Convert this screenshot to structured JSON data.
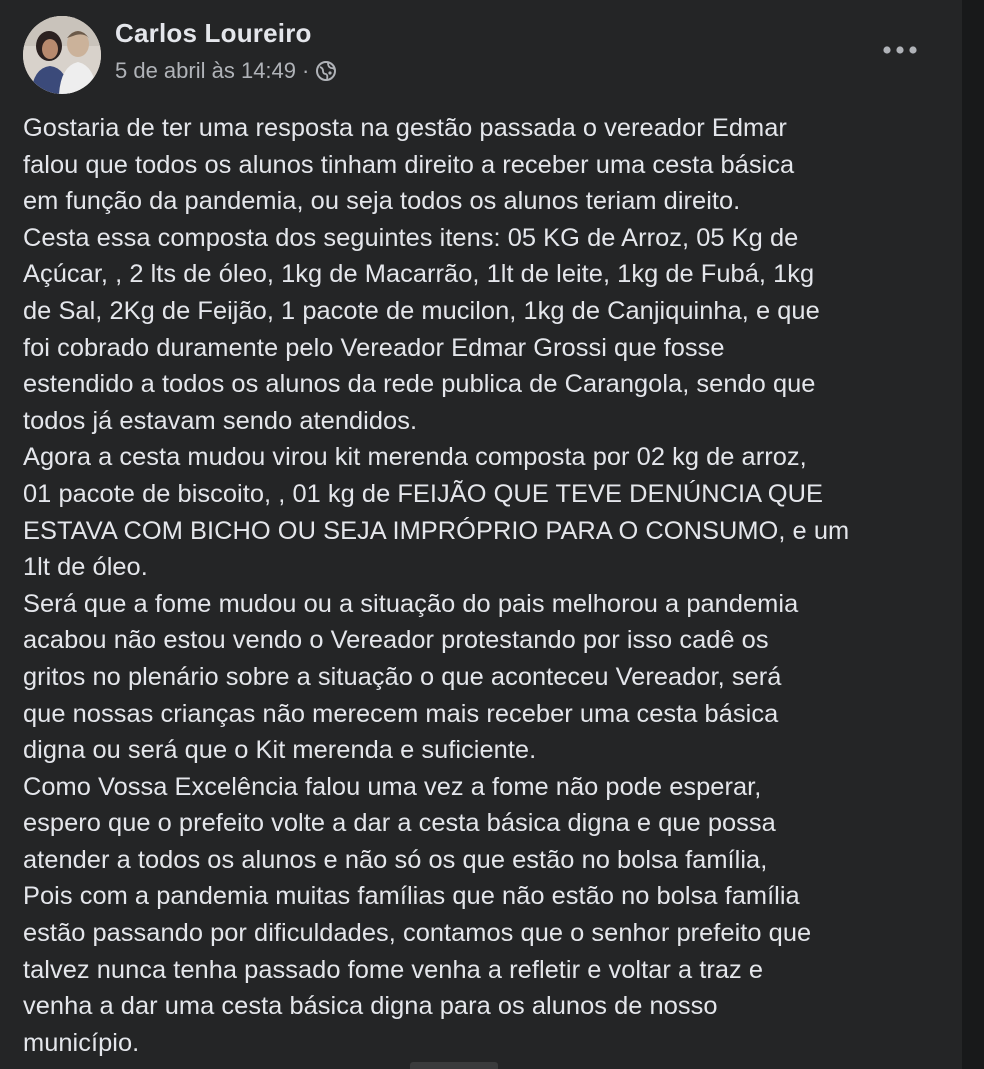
{
  "post": {
    "author": "Carlos Loureiro",
    "timestamp": "5 de abril às 14:49",
    "separator": "·",
    "privacy_icon": "globe-icon",
    "more_icon": "more-options-icon",
    "lines": [
      "Gostaria de ter uma resposta na gestão passada o vereador Edmar",
      "falou que todos os alunos tinham direito a receber uma cesta básica",
      "em função da pandemia, ou seja todos os alunos teriam direito.",
      "Cesta essa composta dos seguintes itens: 05 KG de Arroz, 05 Kg de",
      "Açúcar, , 2 lts de óleo, 1kg de Macarrão, 1lt de leite, 1kg de Fubá, 1kg",
      "de Sal, 2Kg de Feijão, 1 pacote de mucilon, 1kg de Canjiquinha, e que",
      "foi cobrado duramente pelo Vereador Edmar Grossi que fosse",
      "estendido a todos os alunos da rede publica de Carangola, sendo que",
      "todos já estavam sendo atendidos.",
      "Agora a cesta mudou virou kit merenda composta por 02 kg de arroz,",
      "01 pacote de biscoito, , 01 kg de FEIJÃO QUE TEVE DENÚNCIA QUE",
      "ESTAVA COM BICHO OU SEJA IMPRÓPRIO PARA O CONSUMO, e um",
      "1lt de óleo.",
      "Será que a fome mudou ou a situação do pais melhorou a pandemia",
      "acabou não estou vendo o Vereador protestando por isso cadê os",
      "gritos no plenário sobre a situação o que aconteceu Vereador, será",
      "que nossas crianças não merecem mais receber uma cesta básica",
      "digna ou será que o Kit merenda e suficiente.",
      "Como Vossa Excelência falou uma vez a fome não pode esperar,",
      "espero que o prefeito volte a dar a cesta básica digna e que possa",
      "atender a todos os alunos e não só os que estão no bolsa família,",
      "Pois com a pandemia muitas famílias que não estão no bolsa família",
      "estão passando por dificuldades, contamos que o senhor prefeito que",
      "talvez nunca tenha passado fome venha a refletir e voltar a traz e",
      "venha a dar uma cesta básica digna para os alunos de nosso",
      "município."
    ]
  },
  "colors": {
    "card_background": "#242526",
    "page_background": "#18191a",
    "primary_text": "#e4e6eb",
    "secondary_text": "#b0b3b8"
  }
}
